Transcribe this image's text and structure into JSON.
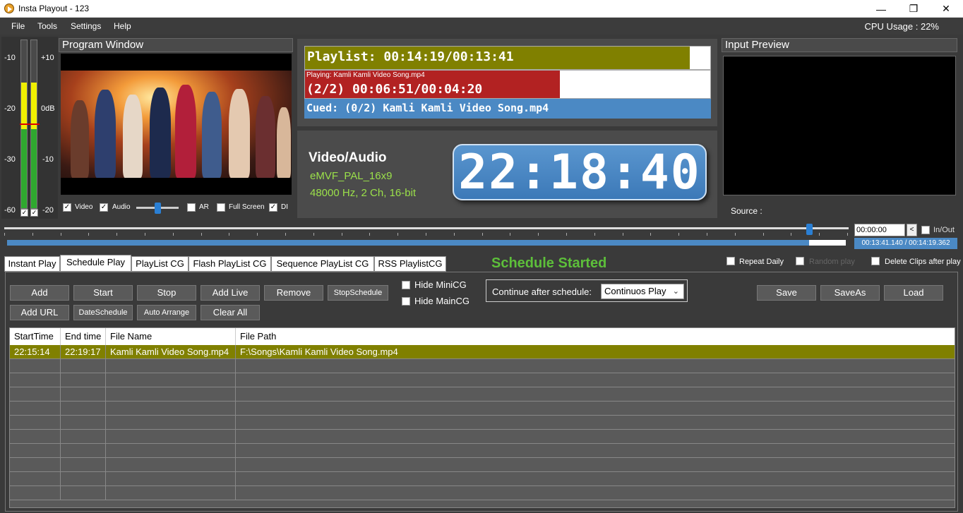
{
  "window": {
    "title": "Insta Playout - 123",
    "minimize": "—",
    "maximize": "❐",
    "close": "✕"
  },
  "menu": {
    "items": [
      "File",
      "Tools",
      "Settings",
      "Help"
    ],
    "cpu_usage": "CPU Usage : 22%"
  },
  "vu_meter": {
    "left_labels": [
      "-10",
      "-20",
      "-30",
      "-60"
    ],
    "right_labels": [
      "+10",
      "0dB",
      "-10",
      "-20"
    ],
    "checks": [
      "✓",
      "✓"
    ]
  },
  "program_window": {
    "title": "Program Window",
    "controls": {
      "video": "Video",
      "audio": "Audio",
      "ar": "AR",
      "full_screen": "Full Screen",
      "di": "DI",
      "check_mark": "✓"
    }
  },
  "playlist_status": {
    "playlist": "Playlist: 00:14:19/00:13:41",
    "playing_label": "Playing: Kamli Kamli Video Song.mp4",
    "playing_time": "(2/2) 00:06:51/00:04:20",
    "cued": "Cued: (0/2) Kamli Kamli Video Song.mp4",
    "playlist_fraction": 0.95,
    "playing_fraction": 0.63
  },
  "media_info": {
    "title": "Video/Audio",
    "video_format": "eMVF_PAL_16x9",
    "audio_format": "48000 Hz, 2 Ch, 16-bit",
    "clock": "22:18:40"
  },
  "input_preview": {
    "title": "Input Preview",
    "source_label": "Source :"
  },
  "seek": {
    "timecode": "00:00:00",
    "prev_label": "<",
    "inout_label": "In/Out",
    "duration": "00:13:41.140 / 00:14:19.362",
    "position_fraction": 0.95,
    "progress_fraction": 0.956
  },
  "tabs": [
    "Instant Play",
    "Schedule Play",
    "PlayList CG",
    "Flash PlayList CG",
    "Sequence PlayList CG",
    "RSS PlaylistCG"
  ],
  "schedule_status": "Schedule Started",
  "options": {
    "repeat_daily": "Repeat Daily",
    "random_play": "Random play",
    "delete_clips": "Delete Clips after play"
  },
  "schedule": {
    "buttons_row1": [
      "Add",
      "Start",
      "Stop",
      "Add Live",
      "Remove",
      "StopSchedule"
    ],
    "buttons_row2": [
      "Add URL",
      "DateSchedule",
      "Auto Arrange",
      "Clear All"
    ],
    "hide_minicg": "Hide MiniCG",
    "hide_maincg": "Hide MainCG",
    "continue_label": "Continue after schedule:",
    "continue_value": "Continuos Play",
    "right_buttons": [
      "Save",
      "SaveAs",
      "Load"
    ],
    "table": {
      "columns": [
        "StartTime",
        "End time",
        "File Name",
        "File Path"
      ],
      "rows": [
        [
          "22:15:14",
          "22:19:17",
          "Kamli Kamli Video Song.mp4",
          "F:\\Songs\\Kamli Kamli Video Song.mp4"
        ]
      ]
    }
  }
}
